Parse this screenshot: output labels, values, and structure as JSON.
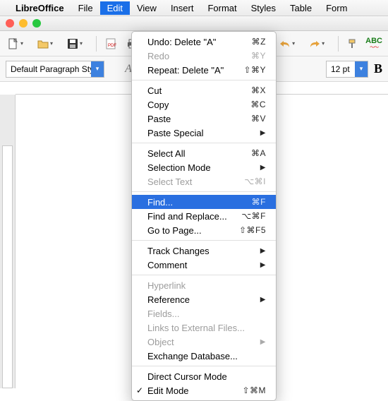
{
  "menubar": {
    "app_name": "LibreOffice",
    "items": [
      "File",
      "Edit",
      "View",
      "Insert",
      "Format",
      "Styles",
      "Table",
      "Form"
    ],
    "active_index": 1
  },
  "toolbar1": {
    "icons": [
      "new-doc",
      "open",
      "save",
      "pdf-export",
      "print",
      "undo",
      "redo",
      "paint-format",
      "spellcheck"
    ]
  },
  "toolbar2": {
    "paragraph_style": "Default Paragraph Style",
    "font_size": "12 pt",
    "bold_label": "B",
    "spell_label": "ABC"
  },
  "edit_menu": {
    "groups": [
      [
        {
          "label": "Undo: Delete \"A\"",
          "shortcut": "⌘Z",
          "enabled": true
        },
        {
          "label": "Redo",
          "shortcut": "⌘Y",
          "enabled": false
        },
        {
          "label": "Repeat: Delete \"A\"",
          "shortcut": "⇧⌘Y",
          "enabled": true
        }
      ],
      [
        {
          "label": "Cut",
          "shortcut": "⌘X",
          "enabled": true
        },
        {
          "label": "Copy",
          "shortcut": "⌘C",
          "enabled": true
        },
        {
          "label": "Paste",
          "shortcut": "⌘V",
          "enabled": true
        },
        {
          "label": "Paste Special",
          "submenu": true,
          "enabled": true
        }
      ],
      [
        {
          "label": "Select All",
          "shortcut": "⌘A",
          "enabled": true
        },
        {
          "label": "Selection Mode",
          "submenu": true,
          "enabled": true
        },
        {
          "label": "Select Text",
          "shortcut": "⌥⌘I",
          "enabled": false
        }
      ],
      [
        {
          "label": "Find...",
          "shortcut": "⌘F",
          "enabled": true,
          "highlight": true
        },
        {
          "label": "Find and Replace...",
          "shortcut": "⌥⌘F",
          "enabled": true
        },
        {
          "label": "Go to Page...",
          "shortcut": "⇧⌘F5",
          "enabled": true
        }
      ],
      [
        {
          "label": "Track Changes",
          "submenu": true,
          "enabled": true
        },
        {
          "label": "Comment",
          "submenu": true,
          "enabled": true
        }
      ],
      [
        {
          "label": "Hyperlink",
          "enabled": false
        },
        {
          "label": "Reference",
          "submenu": true,
          "enabled": true
        },
        {
          "label": "Fields...",
          "enabled": false
        },
        {
          "label": "Links to External Files...",
          "enabled": false
        },
        {
          "label": "Object",
          "submenu": true,
          "enabled": false
        },
        {
          "label": "Exchange Database...",
          "enabled": true
        }
      ],
      [
        {
          "label": "Direct Cursor Mode",
          "enabled": true
        },
        {
          "label": "Edit Mode",
          "shortcut": "⇧⌘M",
          "enabled": true,
          "checked": true
        }
      ]
    ]
  }
}
